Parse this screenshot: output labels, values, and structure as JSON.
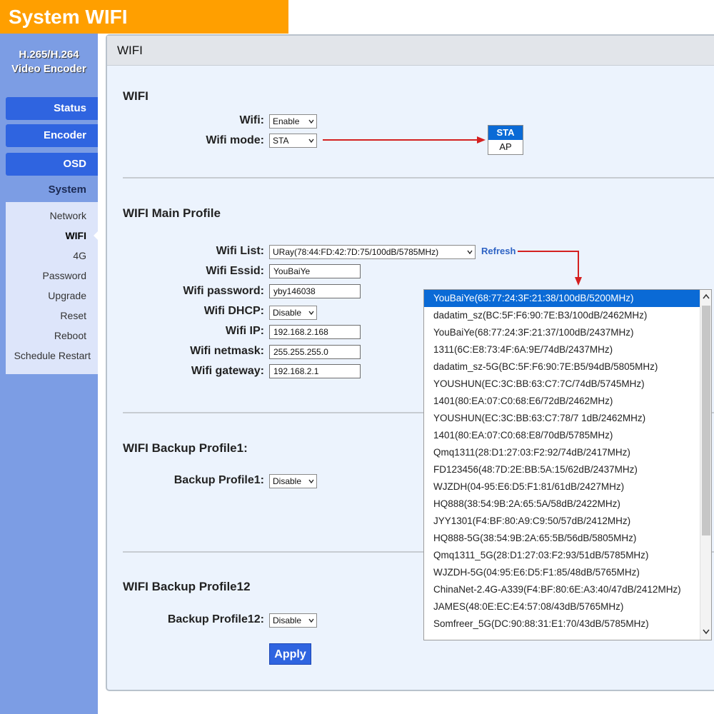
{
  "banner": {
    "title": "System WIFI"
  },
  "sidebar": {
    "brand_line1": "H.265/H.264",
    "brand_line2": "Video Encoder",
    "nav": [
      "Status",
      "Encoder",
      "OSD"
    ],
    "system_label": "System",
    "subnav": [
      "Network",
      "WIFI",
      "4G",
      "Password",
      "Upgrade",
      "Reset",
      "Reboot",
      "Schedule Restart"
    ],
    "active_subnav": "WIFI"
  },
  "panel": {
    "header": "WIFI"
  },
  "wifi": {
    "section_title": "WIFI",
    "wifi_label": "Wifi:",
    "wifi_value": "Enable",
    "mode_label": "Wifi mode:",
    "mode_value": "STA",
    "mode_options": [
      "STA",
      "AP"
    ]
  },
  "main_profile": {
    "section_title": "WIFI Main Profile",
    "list_label": "Wifi List:",
    "list_value": "URay(78:44:FD:42:7D:75/100dB/5785MHz)",
    "refresh_label": "Refresh",
    "essid_label": "Wifi Essid:",
    "essid_value": "YouBaiYe",
    "password_label": "Wifi password:",
    "password_value": "yby146038",
    "dhcp_label": "Wifi DHCP:",
    "dhcp_value": "Disable",
    "ip_label": "Wifi IP:",
    "ip_value": "192.168.2.168",
    "netmask_label": "Wifi netmask:",
    "netmask_value": "255.255.255.0",
    "gateway_label": "Wifi gateway:",
    "gateway_value": "192.168.2.1"
  },
  "backup1": {
    "section_title": "WIFI Backup Profile1:",
    "label": "Backup Profile1:",
    "value": "Disable"
  },
  "backup12": {
    "section_title": "WIFI Backup Profile12",
    "label": "Backup Profile12:",
    "value": "Disable"
  },
  "apply_label": "Apply",
  "wifi_list_options": [
    "YouBaiYe(68:77:24:3F:21:38/100dB/5200MHz)",
    "dadatim_sz(BC:5F:F6:90:7E:B3/100dB/2462MHz)",
    "YouBaiYe(68:77:24:3F:21:37/100dB/2437MHz)",
    "1311(6C:E8:73:4F:6A:9E/74dB/2437MHz)",
    "dadatim_sz-5G(BC:5F:F6:90:7E:B5/94dB/5805MHz)",
    "YOUSHUN(EC:3C:BB:63:C7:7C/74dB/5745MHz)",
    "1401(80:EA:07:C0:68:E6/72dB/2462MHz)",
    "YOUSHUN(EC:3C:BB:63:C7:78/7 1dB/2462MHz)",
    "1401(80:EA:07:C0:68:E8/70dB/5785MHz)",
    "Qmq1311(28:D1:27:03:F2:92/74dB/2417MHz)",
    "FD123456(48:7D:2E:BB:5A:15/62dB/2437MHz)",
    "WJZDH(04-95:E6:D5:F1:81/61dB/2427MHz)",
    "HQ888(38:54:9B:2A:65:5A/58dB/2422MHz)",
    "JYY1301(F4:BF:80:A9:C9:50/57dB/2412MHz)",
    "HQ888-5G(38:54:9B:2A:65:5B/56dB/5805MHz)",
    "Qmq1311_5G(28:D1:27:03:F2:93/51dB/5785MHz)",
    "WJZDH-5G(04:95:E6:D5:F1:85/48dB/5765MHz)",
    "ChinaNet-2.4G-A339(F4:BF:80:6E:A3:40/47dB/2412MHz)",
    "JAMES(48:0E:EC:E4:57:08/43dB/5765MHz)",
    "Somfreer_5G(DC:90:88:31:E1:70/43dB/5785MHz)"
  ],
  "colors": {
    "banner": "#ff9f00",
    "sidebar": "#7c9de4",
    "nav_button": "#2f64e0",
    "highlight": "#0a6ad6",
    "arrow": "#d42020"
  }
}
